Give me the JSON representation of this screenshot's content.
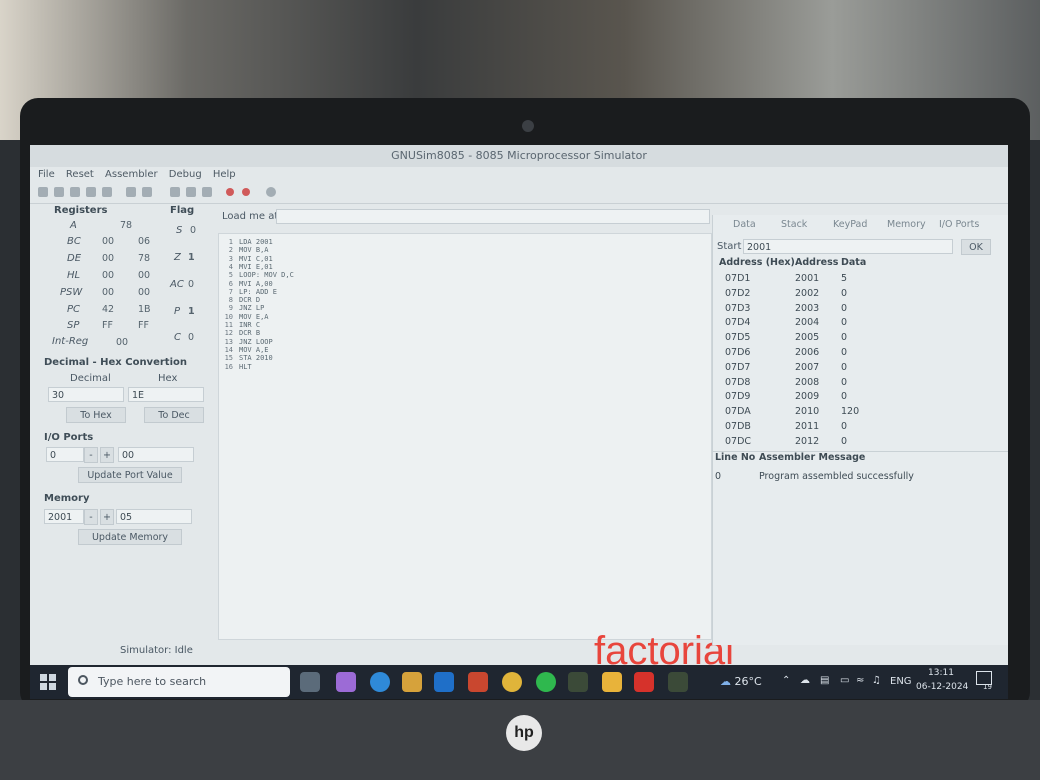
{
  "window": {
    "title": "GNUSim8085 - 8085 Microprocessor Simulator"
  },
  "menu": [
    "File",
    "Reset",
    "Assembler",
    "Debug",
    "Help"
  ],
  "registers": {
    "header": "Registers",
    "flag_header": "Flag",
    "rows": [
      {
        "name": "A",
        "v1": "78",
        "v2": ""
      },
      {
        "name": "BC",
        "v1": "00",
        "v2": "06"
      },
      {
        "name": "DE",
        "v1": "00",
        "v2": "78"
      },
      {
        "name": "HL",
        "v1": "00",
        "v2": "00"
      },
      {
        "name": "PSW",
        "v1": "00",
        "v2": "00"
      },
      {
        "name": "PC",
        "v1": "42",
        "v2": "1B"
      },
      {
        "name": "SP",
        "v1": "FF",
        "v2": "FF"
      },
      {
        "name": "Int-Reg",
        "v1": "00",
        "v2": ""
      }
    ],
    "flags": [
      {
        "name": "S",
        "value": "0"
      },
      {
        "name": "Z",
        "value": "1"
      },
      {
        "name": "AC",
        "value": "0"
      },
      {
        "name": "P",
        "value": "1"
      },
      {
        "name": "C",
        "value": "0"
      }
    ]
  },
  "conversion": {
    "title": "Decimal - Hex Convertion",
    "decimal_label": "Decimal",
    "hex_label": "Hex",
    "decimal_value": "30",
    "hex_value": "1E",
    "to_hex": "To Hex",
    "to_dec": "To Dec"
  },
  "io_ports": {
    "title": "I/O Ports",
    "port": "0",
    "minus": "-",
    "plus": "+",
    "value": "00",
    "update": "Update Port Value"
  },
  "memory": {
    "title": "Memory",
    "address": "2001",
    "minus": "-",
    "plus": "+",
    "value": "05",
    "update": "Update Memory"
  },
  "editor": {
    "load_label": "Load me at",
    "load_value": "",
    "lines": [
      {
        "n": "1",
        "code": "LDA 2001"
      },
      {
        "n": "2",
        "code": "MOV B,A"
      },
      {
        "n": "3",
        "code": "MVI C,01"
      },
      {
        "n": "4",
        "code": "MVI E,01"
      },
      {
        "n": "5",
        "code": "LOOP: MOV D,C"
      },
      {
        "n": "6",
        "code": "MVI A,00"
      },
      {
        "n": "7",
        "code": "LP: ADD E"
      },
      {
        "n": "8",
        "code": "DCR D"
      },
      {
        "n": "9",
        "code": "JNZ LP"
      },
      {
        "n": "10",
        "code": "MOV E,A"
      },
      {
        "n": "11",
        "code": "INR C"
      },
      {
        "n": "12",
        "code": "DCR B"
      },
      {
        "n": "13",
        "code": "JNZ LOOP"
      },
      {
        "n": "14",
        "code": "MOV A,E"
      },
      {
        "n": "15",
        "code": "STA 2010"
      },
      {
        "n": "16",
        "code": "HLT"
      }
    ]
  },
  "overlay_text": "factorial",
  "right_panel": {
    "tabs": [
      "Data",
      "Stack",
      "KeyPad",
      "Memory",
      "I/O Ports"
    ],
    "start_label": "Start",
    "start_value": "2001",
    "ok": "OK",
    "headers": [
      "Address (Hex)",
      "Address",
      "Data"
    ],
    "rows": [
      {
        "hex": "07D1",
        "addr": "2001",
        "data": "5"
      },
      {
        "hex": "07D2",
        "addr": "2002",
        "data": "0"
      },
      {
        "hex": "07D3",
        "addr": "2003",
        "data": "0"
      },
      {
        "hex": "07D4",
        "addr": "2004",
        "data": "0"
      },
      {
        "hex": "07D5",
        "addr": "2005",
        "data": "0"
      },
      {
        "hex": "07D6",
        "addr": "2006",
        "data": "0"
      },
      {
        "hex": "07D7",
        "addr": "2007",
        "data": "0"
      },
      {
        "hex": "07D8",
        "addr": "2008",
        "data": "0"
      },
      {
        "hex": "07D9",
        "addr": "2009",
        "data": "0"
      },
      {
        "hex": "07DA",
        "addr": "2010",
        "data": "120"
      },
      {
        "hex": "07DB",
        "addr": "2011",
        "data": "0"
      },
      {
        "hex": "07DC",
        "addr": "2012",
        "data": "0"
      }
    ],
    "msg_headers": [
      "Line No",
      "Assembler Message"
    ],
    "msg_row": {
      "line": "0",
      "message": "Program assembled successfully"
    }
  },
  "status": "Simulator: Idle",
  "taskbar": {
    "search_placeholder": "Type here to search",
    "weather": "26°C",
    "lang": "ENG",
    "time": "13:11",
    "date": "06-12-2024",
    "notification_count": "19"
  },
  "colors": {
    "watermark": "#e8453c",
    "taskbar": "#1f2630"
  }
}
